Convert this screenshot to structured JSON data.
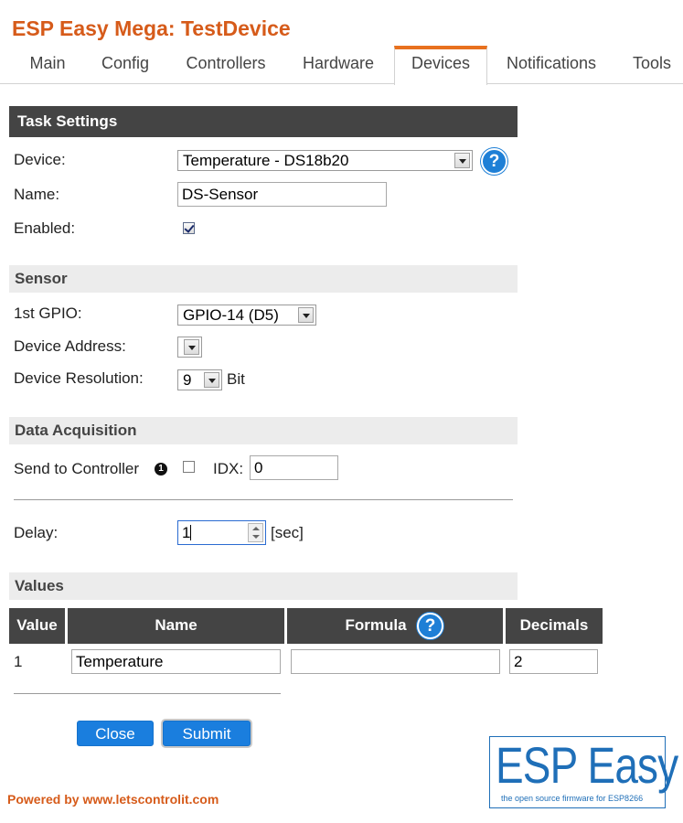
{
  "header": {
    "title": "ESP Easy Mega: TestDevice"
  },
  "tabs": [
    {
      "label": "Main"
    },
    {
      "label": "Config"
    },
    {
      "label": "Controllers"
    },
    {
      "label": "Hardware"
    },
    {
      "label": "Devices"
    },
    {
      "label": "Notifications"
    },
    {
      "label": "Tools"
    }
  ],
  "active_tab": "Devices",
  "task_settings": {
    "heading": "Task Settings",
    "device_label": "Device:",
    "device_value": "Temperature - DS18b20",
    "name_label": "Name:",
    "name_value": "DS-Sensor",
    "enabled_label": "Enabled:",
    "enabled": true,
    "help_glyph": "?"
  },
  "sensor": {
    "heading": "Sensor",
    "gpio_label": "1st GPIO:",
    "gpio_value": "GPIO-14 (D5)",
    "address_label": "Device Address:",
    "address_value": "",
    "resolution_label": "Device Resolution:",
    "resolution_value": "9",
    "resolution_unit": "Bit"
  },
  "data_acquisition": {
    "heading": "Data Acquisition",
    "send_label": "Send to Controller",
    "send_info_glyph": "1",
    "send_checked": false,
    "idx_label": "IDX:",
    "idx_value": "0",
    "delay_label": "Delay:",
    "delay_value": "1",
    "delay_unit": "[sec]"
  },
  "values": {
    "heading": "Values",
    "columns": [
      "Value",
      "Name",
      "Formula",
      "Decimals"
    ],
    "rows": [
      {
        "value": "1",
        "name": "Temperature",
        "formula": "",
        "decimals": "2"
      }
    ]
  },
  "buttons": {
    "close": "Close",
    "submit": "Submit"
  },
  "footer": {
    "powered": "Powered by www.letscontrolit.com"
  },
  "logo": {
    "text": "ESP Easy",
    "tagline": "the open source firmware for ESP8266"
  },
  "colors": {
    "accent": "#d65b1a",
    "tab_active": "#e8711e",
    "button": "#1a7ede",
    "section_dark": "#444444"
  },
  "icons": {
    "help": "question-circle-icon",
    "info": "info-dot-icon",
    "dropdown": "chevron-down-icon"
  }
}
